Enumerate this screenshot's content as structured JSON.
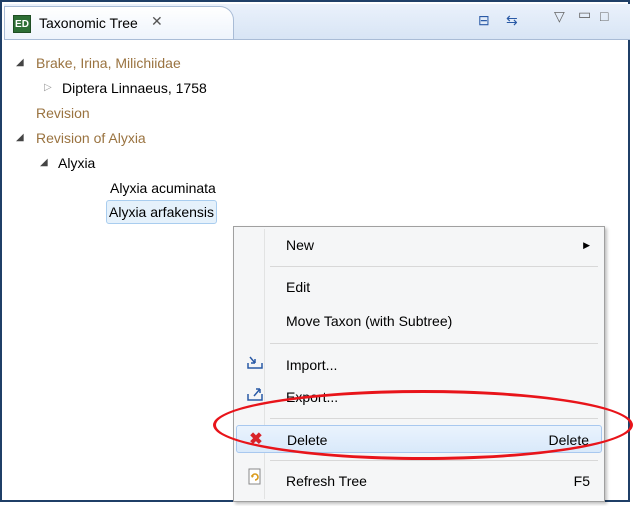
{
  "view": {
    "title": "Taxonomic Tree",
    "icon_text": "ED",
    "close_glyph": "✕",
    "toolbar": {
      "collapse_icon": "collapse-all-icon",
      "link_icon": "link-with-editor-icon",
      "menu_icon": "view-menu-icon",
      "minimize_icon": "minimize-icon",
      "maximize_icon": "maximize-icon"
    }
  },
  "tree": {
    "nodes": [
      {
        "label": "Brake, Irina, Milichiidae",
        "expander": "◢"
      },
      {
        "label": "Diptera Linnaeus, 1758",
        "expander": "▷"
      },
      {
        "label": "Revision",
        "expander": ""
      },
      {
        "label": "Revision of Alyxia",
        "expander": "◢"
      },
      {
        "label": "Alyxia",
        "expander": "◢"
      },
      {
        "label": "Alyxia acuminata",
        "expander": ""
      },
      {
        "label": "Alyxia arfakensis",
        "expander": ""
      }
    ]
  },
  "context_menu": {
    "new": {
      "label": "New",
      "submenu_arrow": "▶"
    },
    "edit": {
      "label": "Edit"
    },
    "move": {
      "label": "Move Taxon (with Subtree)"
    },
    "import": {
      "label": "Import..."
    },
    "export": {
      "label": "Export..."
    },
    "delete": {
      "label": "Delete",
      "accelerator": "Delete"
    },
    "refresh": {
      "label": "Refresh Tree",
      "accelerator": "F5"
    }
  },
  "colors": {
    "accent_brown": "#9a7340",
    "annotation_red": "#e8141a",
    "selection_blue": "#e5f1fb"
  }
}
